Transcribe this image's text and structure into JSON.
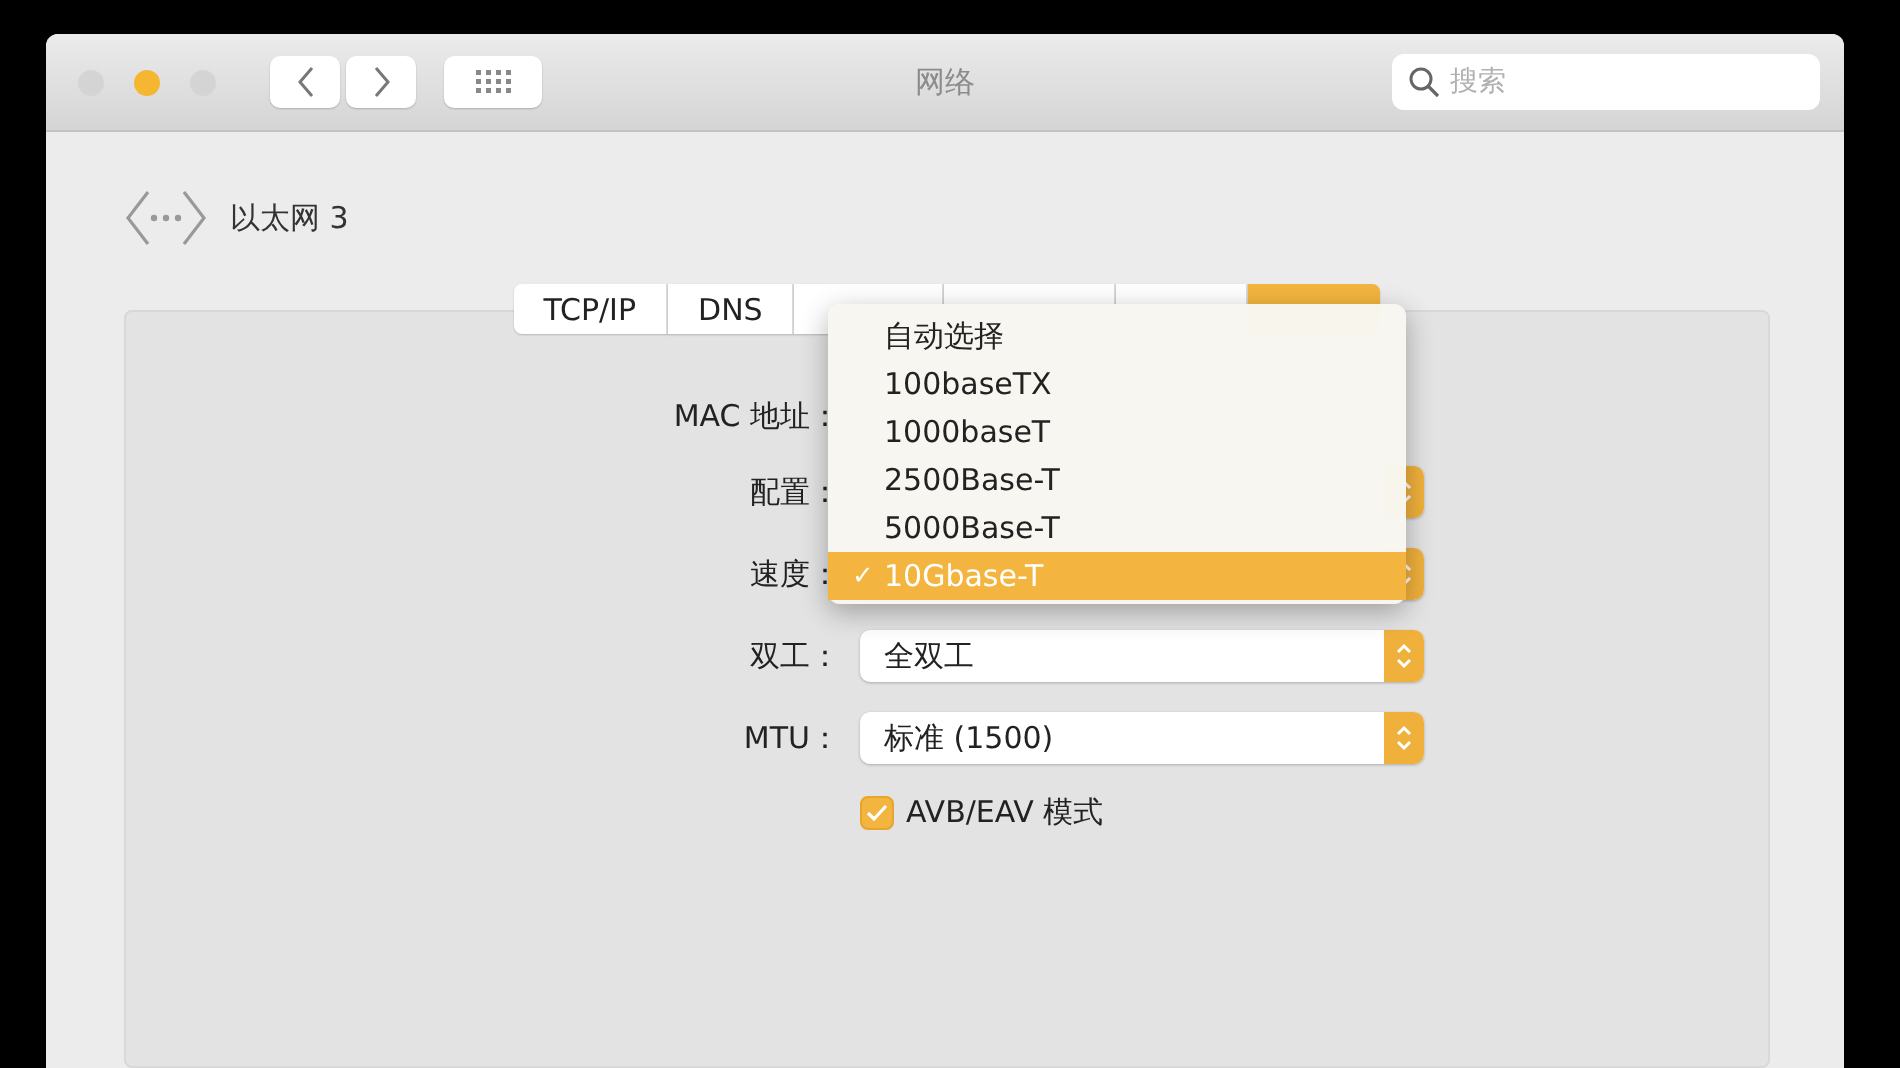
{
  "window": {
    "title": "网络",
    "search": {
      "placeholder": "搜索"
    }
  },
  "interface": {
    "name": "以太网 3"
  },
  "tabs": [
    {
      "label": "TCP/IP",
      "selected": false
    },
    {
      "label": "DNS",
      "selected": false
    },
    {
      "selected": false
    },
    {
      "selected": false
    },
    {
      "selected": false
    },
    {
      "selected": true
    }
  ],
  "form": [
    {
      "kind": "static",
      "label": "MAC 地址："
    },
    {
      "kind": "popup",
      "label": "配置："
    },
    {
      "kind": "popup",
      "label": "速度：",
      "open": true
    },
    {
      "kind": "popup",
      "label": "双工：",
      "value": "全双工"
    },
    {
      "kind": "popup",
      "label": "MTU：",
      "value": "标准 (1500)"
    }
  ],
  "menu": {
    "check_mark": "✓",
    "items": [
      {
        "label": "自动选择",
        "selected": false
      },
      {
        "label": "100baseTX",
        "selected": false
      },
      {
        "label": "1000baseT",
        "selected": false
      },
      {
        "label": "2500Base-T",
        "selected": false
      },
      {
        "label": "5000Base-T",
        "selected": false
      },
      {
        "label": "10Gbase-T",
        "selected": true
      }
    ]
  },
  "checkbox": {
    "label": "AVB/EAV 模式",
    "checked": true
  }
}
